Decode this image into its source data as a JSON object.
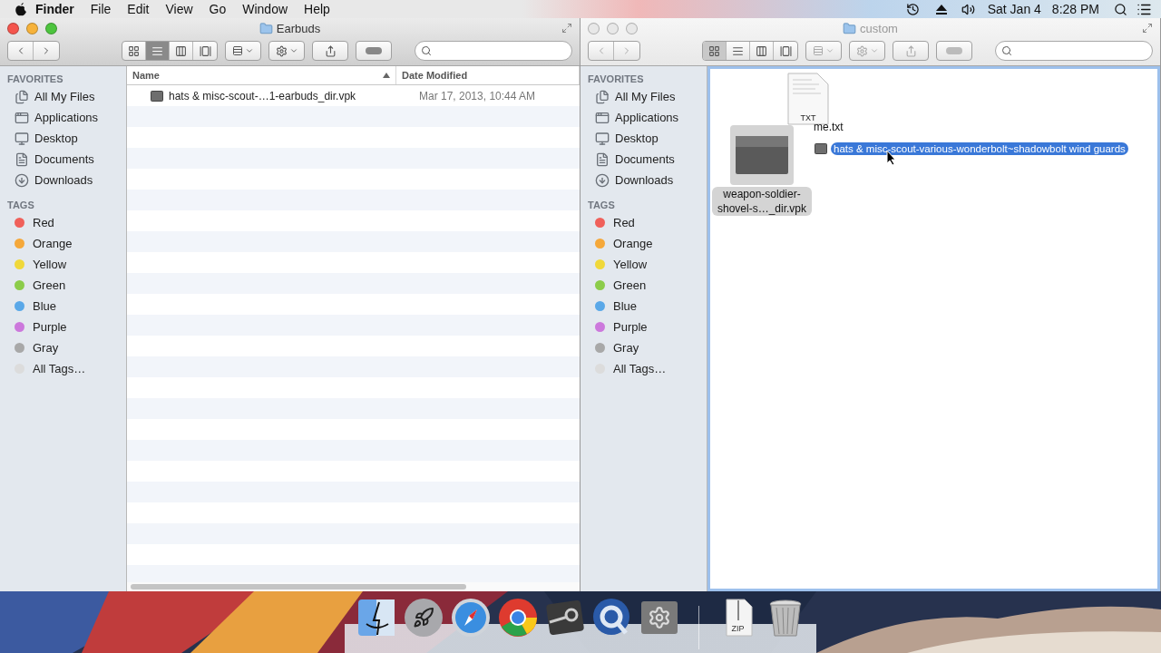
{
  "menubar": {
    "app": "Finder",
    "items": [
      "File",
      "Edit",
      "View",
      "Go",
      "Window",
      "Help"
    ],
    "date": "Sat Jan 4",
    "time": "8:28 PM"
  },
  "windows": [
    {
      "title": "Earbuds",
      "active": true,
      "views": [
        {
          "kind": "icon",
          "selected": false
        },
        {
          "kind": "list",
          "selected": true
        },
        {
          "kind": "column",
          "selected": false
        },
        {
          "kind": "flow",
          "selected": false
        }
      ],
      "sidebar": {
        "favorites_heading": "FAVORITES",
        "favorites": [
          {
            "kind": "files",
            "label": "All My Files"
          },
          {
            "kind": "apps",
            "label": "Applications"
          },
          {
            "kind": "desktop",
            "label": "Desktop"
          },
          {
            "kind": "documents",
            "label": "Documents"
          },
          {
            "kind": "downloads",
            "label": "Downloads"
          }
        ],
        "tags_heading": "TAGS",
        "tags": [
          {
            "label": "Red",
            "color": "#f0605a"
          },
          {
            "label": "Orange",
            "color": "#f5a83a"
          },
          {
            "label": "Yellow",
            "color": "#f0d83a"
          },
          {
            "label": "Green",
            "color": "#8ccc4a"
          },
          {
            "label": "Blue",
            "color": "#5aa8e8"
          },
          {
            "label": "Purple",
            "color": "#cc78dc"
          },
          {
            "label": "Gray",
            "color": "#a8a8a8"
          },
          {
            "label": "All Tags…",
            "color": "#dcdcdc"
          }
        ]
      },
      "content": {
        "kind": "list",
        "columns": [
          {
            "label": "Name",
            "sorted": true
          },
          {
            "label": "Date Modified",
            "sorted": false
          }
        ],
        "rows": [
          {
            "name": "hats & misc-scout-…1-earbuds_dir.vpk",
            "date": "Mar 17, 2013, 10:44 AM"
          }
        ]
      }
    },
    {
      "title": "custom",
      "active": false,
      "views": [
        {
          "kind": "icon",
          "selected": true
        },
        {
          "kind": "list",
          "selected": false
        },
        {
          "kind": "column",
          "selected": false
        },
        {
          "kind": "flow",
          "selected": false
        }
      ],
      "sidebar": {
        "favorites_heading": "FAVORITES",
        "favorites": [
          {
            "kind": "files",
            "label": "All My Files"
          },
          {
            "kind": "apps",
            "label": "Applications"
          },
          {
            "kind": "desktop",
            "label": "Desktop"
          },
          {
            "kind": "documents",
            "label": "Documents"
          },
          {
            "kind": "downloads",
            "label": "Downloads"
          }
        ],
        "tags_heading": "TAGS",
        "tags": [
          {
            "label": "Red",
            "color": "#f0605a"
          },
          {
            "label": "Orange",
            "color": "#f5a83a"
          },
          {
            "label": "Yellow",
            "color": "#f0d83a"
          },
          {
            "label": "Green",
            "color": "#8ccc4a"
          },
          {
            "label": "Blue",
            "color": "#5aa8e8"
          },
          {
            "label": "Purple",
            "color": "#cc78dc"
          },
          {
            "label": "Gray",
            "color": "#a8a8a8"
          },
          {
            "label": "All Tags…",
            "color": "#dcdcdc"
          }
        ]
      },
      "content": {
        "kind": "icons",
        "items": [
          {
            "kind": "document",
            "badge": "TXT",
            "name": "me.txt"
          },
          {
            "kind": "archive",
            "name": "weapon-soldier-shovel-s…_dir.vpk",
            "selected": true
          },
          {
            "kind": "dragged",
            "name": "hats & misc-scout-various-wonderbolt~shadowbolt wind guards",
            "selected": true
          }
        ]
      }
    }
  ],
  "dock": [
    {
      "kind": "finder"
    },
    {
      "kind": "launchpad"
    },
    {
      "kind": "safari"
    },
    {
      "kind": "chrome"
    },
    {
      "kind": "steam"
    },
    {
      "kind": "quicktime"
    },
    {
      "kind": "preferences"
    },
    {
      "kind": "separator"
    },
    {
      "kind": "zip",
      "badge": "ZIP"
    },
    {
      "kind": "trash"
    }
  ]
}
